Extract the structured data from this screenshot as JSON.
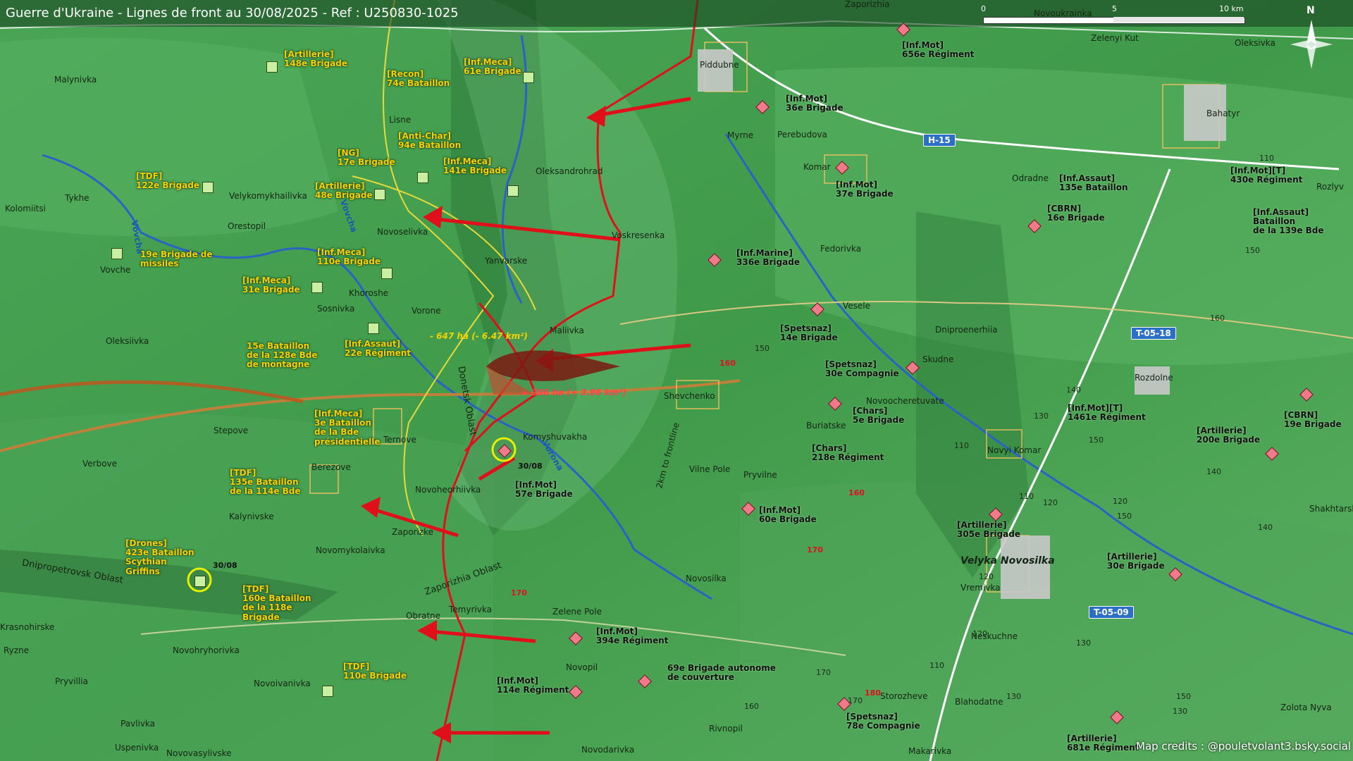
{
  "title": "Guerre d'Ukraine - Lignes de front au 30/08/2025 - Ref : U250830-1025",
  "scale_bar": {
    "labels": [
      "0",
      "5",
      "10 km"
    ]
  },
  "north_label": "N",
  "credits": "Map credits : @pouletvolant3.bsky.social",
  "colors": {
    "ua_unit": "#c8f0a0",
    "ru_unit": "#f07a8a",
    "front_line": "#e0101a",
    "terrain": "#3f9a4a",
    "road_badge": "#2b6fc7"
  },
  "towns": [
    "Malynivka",
    "Lisne",
    "Piddubne",
    "Myrne",
    "Perebudova",
    "Komar",
    "Oleksivka",
    "Zaporizhia",
    "Zelenyi Kut",
    "Novoukrainka",
    "Bahatyr",
    "Odradne",
    "Rozdolne",
    "Oleksandrohrad",
    "Velykomykhailivka",
    "Orestopil",
    "Tykhe",
    "Kolomiitsi",
    "Vovche",
    "Novoselivka",
    "Voskresenka",
    "Yanvarske",
    "Khoroshe",
    "Vorone",
    "Sosnivka",
    "Maliivka",
    "Fedorivka",
    "Vesele",
    "Dniproenerhiia",
    "Skudne",
    "Shevchenko",
    "Novoocheretuvate",
    "Oleksiivka",
    "Stepove",
    "Ternove",
    "Komyshuvakha",
    "Buriatske",
    "Novyi Komar",
    "Verbove",
    "Berezove",
    "Novoheorhiivka",
    "Vilne Pole",
    "Pryvilne",
    "Kalynivske",
    "Zaporizke",
    "Novomykolaivka",
    "Velyka Novosilka",
    "Vremivka",
    "Shakhtarske",
    "Novosilka",
    "Obratne",
    "Temyrivka",
    "Zelene Pole",
    "Neskuchne",
    "Krasnohirske",
    "Ryzne",
    "Novohryhorivka",
    "Novopil",
    "Pryvillia",
    "Novoivanivka",
    "Storozheve",
    "Blahodatne",
    "Pavlivka",
    "Rivnopil",
    "Zolota Nyva",
    "Uspenivka",
    "Novovasylivske",
    "Novodarivka",
    "Makarivka",
    "Rozlyv"
  ],
  "oblasts": [
    "Donetsk Oblast",
    "Dnipropetrovsk Oblast",
    "Zaporizhia Oblast"
  ],
  "rivers": [
    "Vovcha",
    "Vovcha",
    "Vorona"
  ],
  "roads": [
    "H-15",
    "T-05-18",
    "T-05-09"
  ],
  "line_label": "2km to frontline",
  "areas": {
    "loss": "- 647 ha (- 6.47 km²)",
    "gain": "+ 386 ha (+ 3.86 km²)"
  },
  "dates": [
    "30/08",
    "30/08"
  ],
  "units_ua": [
    "[Artillerie]\n148e Brigade",
    "[Recon]\n74e Bataillon",
    "[Inf.Meca]\n61e Brigade",
    "[Anti-Char]\n94e Bataillon",
    "[NG]\n17e Brigade",
    "[Inf.Meca]\n141e Brigade",
    "[TDF]\n122e Brigade",
    "[Artillerie]\n48e Brigade",
    "19e Brigade de\nmissiles",
    "[Inf.Meca]\n110e Brigade",
    "[Inf.Meca]\n31e Brigade",
    "[Inf.Assaut]\n22e Régiment",
    "15e Bataillon\nde la 128e Bde\nde montagne",
    "[Inf.Meca]\n3e Bataillon\nde la Bde\nprésidentielle",
    "[TDF]\n135e Bataillon\nde la 114e Bde",
    "[Drones]\n423e Bataillon\nScythian\nGriffins",
    "[TDF]\n160e Bataillon\nde la 118e\nBrigade",
    "[TDF]\n110e Brigade"
  ],
  "units_ru": [
    "[Inf.Mot]\n656e Régiment",
    "[Inf.Mot]\n36e Brigade",
    "[Inf.Mot]\n37e Brigade",
    "[Inf.Mot][T]\n430e Régiment",
    "[Inf.Assaut]\n135e Bataillon",
    "[CBRN]\n16e Brigade",
    "[Inf.Assaut]\nBataillon\nde la 139e Bde",
    "[Inf.Marine]\n336e Brigade",
    "[Spetsnaz]\n14e Brigade",
    "[Spetsnaz]\n30e Compagnie",
    "[Chars]\n5e Brigade",
    "[Chars]\n218e Régiment",
    "[Inf.Mot][T]\n1461e Régiment",
    "[CBRN]\n19e Brigade",
    "[Artillerie]\n200e Brigade",
    "[Inf.Mot]\n57e Brigade",
    "[Inf.Mot]\n60e Brigade",
    "[Artillerie]\n305e Brigade",
    "[Artillerie]\n30e Brigade",
    "[Inf.Mot]\n394e Régiment",
    "69e Brigade autonome\nde couverture",
    "[Inf.Mot]\n114e Régiment",
    "[Spetsnaz]\n78e Compagnie",
    "[Artillerie]\n681e Régiment"
  ],
  "altitudes": [
    "110",
    "150",
    "160",
    "160",
    "140",
    "150",
    "130",
    "150",
    "140",
    "120",
    "110",
    "120",
    "150",
    "140",
    "160",
    "170",
    "180",
    "170",
    "120",
    "130",
    "130",
    "150",
    "160",
    "170",
    "170",
    "130",
    "120",
    "110",
    "110"
  ]
}
